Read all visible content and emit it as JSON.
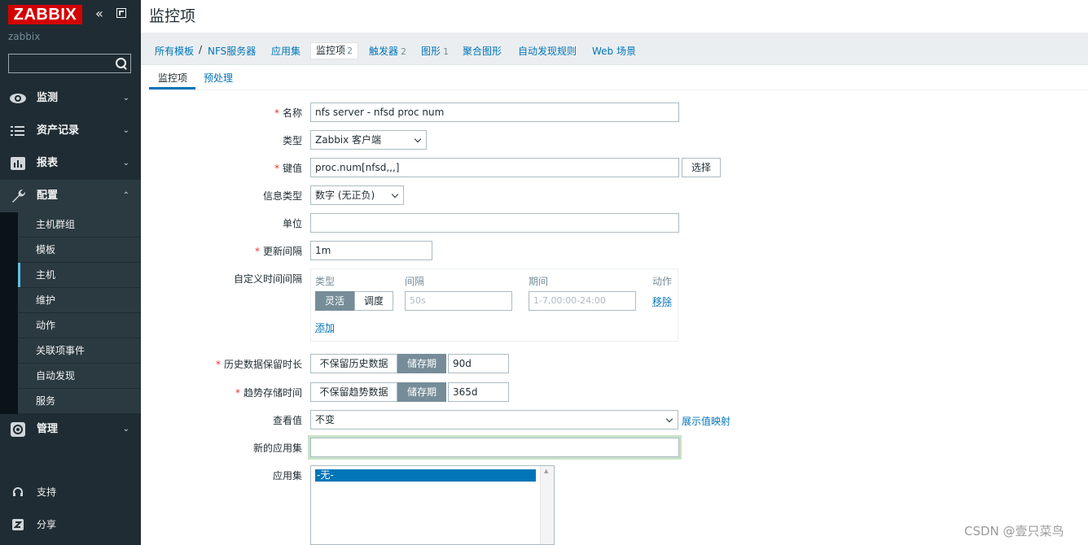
{
  "sidebar": {
    "logo": "ZABBIX",
    "collapse_icon": "double-chevron-left-icon",
    "kiosk_icon": "kiosk-mode-icon",
    "server_name": "zabbix",
    "search_icon": "search-icon",
    "menu": [
      {
        "label": "监测",
        "icon": "eye-icon"
      },
      {
        "label": "资产记录",
        "icon": "list-icon"
      },
      {
        "label": "报表",
        "icon": "bar-chart-icon"
      },
      {
        "label": "配置",
        "icon": "wrench-icon"
      },
      {
        "label": "管理",
        "icon": "gear-icon"
      }
    ],
    "config_submenu": [
      "主机群组",
      "模板",
      "主机",
      "维护",
      "动作",
      "关联项事件",
      "自动发现",
      "服务"
    ],
    "active_submenu": "主机",
    "bottom": [
      {
        "label": "支持",
        "icon": "headset-icon"
      },
      {
        "label": "分享",
        "icon": "share-icon"
      }
    ]
  },
  "page": {
    "title": "监控项"
  },
  "nav": {
    "all_templates": "所有模板",
    "separator": "/",
    "template_name": "NFS服务器",
    "applications": "应用集",
    "items": "监控项",
    "items_count": "2",
    "triggers": "触发器",
    "triggers_count": "2",
    "graphs": "图形",
    "graphs_count": "1",
    "screens": "聚合图形",
    "discovery": "自动发现规则",
    "web": "Web 场景"
  },
  "tabs": {
    "item": "监控项",
    "preprocessing": "预处理"
  },
  "form": {
    "name_label": "名称",
    "name_value": "nfs server - nfsd proc num",
    "type_label": "类型",
    "type_value": "Zabbix 客户端",
    "key_label": "键值",
    "key_value": "proc.num[nfsd,,,]",
    "key_select": "选择",
    "info_type_label": "信息类型",
    "info_type_value": "数字 (无正负)",
    "units_label": "单位",
    "units_value": "",
    "interval_label": "更新间隔",
    "interval_value": "1m",
    "custom_intervals_label": "自定义时间间隔",
    "custom_intervals": {
      "col_type": "类型",
      "col_interval": "间隔",
      "col_period": "期间",
      "col_action": "动作",
      "flexible": "灵活",
      "scheduling": "调度",
      "interval_placeholder": "50s",
      "period_placeholder": "1-7,00:00-24:00",
      "remove": "移除",
      "add": "添加"
    },
    "history_label": "历史数据保留时长",
    "history_no_keep": "不保留历史数据",
    "history_storage": "储存期",
    "history_value": "90d",
    "trends_label": "趋势存储时间",
    "trends_no_keep": "不保留趋势数据",
    "trends_storage": "储存期",
    "trends_value": "365d",
    "show_value_label": "查看值",
    "show_value_value": "不变",
    "show_value_mapping": "展示值映射",
    "new_app_label": "新的应用集",
    "new_app_value": "",
    "apps_label": "应用集",
    "apps_options": [
      "-无-"
    ]
  },
  "watermark": "CSDN @壹只菜鸟"
}
